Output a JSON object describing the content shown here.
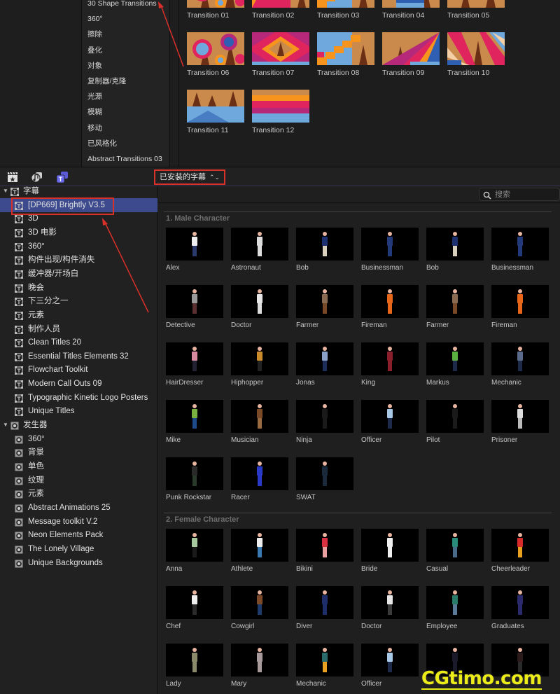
{
  "transitions_browser": {
    "categories": [
      "30 Shape Transitions",
      "360°",
      "擦除",
      "叠化",
      "对象",
      "复制器/克隆",
      "光源",
      "模糊",
      "移动",
      "已风格化",
      "Abstract Transitions 03"
    ],
    "items": [
      {
        "label": "Transition 01",
        "style": "circles"
      },
      {
        "label": "Transition 02",
        "style": "orange-zig"
      },
      {
        "label": "Transition 03",
        "style": "steps"
      },
      {
        "label": "Transition 04",
        "style": "blue-bar"
      },
      {
        "label": "Transition 05",
        "style": "rings"
      },
      {
        "label": "Transition 06",
        "style": "circles"
      },
      {
        "label": "Transition 07",
        "style": "diamond"
      },
      {
        "label": "Transition 08",
        "style": "steps"
      },
      {
        "label": "Transition 09",
        "style": "rays"
      },
      {
        "label": "Transition 10",
        "style": "rays2"
      },
      {
        "label": "Transition 11",
        "style": "trees-water"
      },
      {
        "label": "Transition 12",
        "style": "stripes"
      }
    ]
  },
  "toolbar": {
    "icons": [
      "clapper-star-icon",
      "music-photo-icon",
      "titles-generators-icon"
    ],
    "library_select": "已安装的字幕",
    "library_select_chevron": "⌃⌄"
  },
  "sidebar": {
    "groups": [
      {
        "label": "字幕",
        "expanded": true,
        "icon": "title-icon",
        "items": [
          {
            "label": "[DP669] Brightly V3.5",
            "selected": true
          },
          {
            "label": "3D"
          },
          {
            "label": "3D 电影"
          },
          {
            "label": "360°"
          },
          {
            "label": "构件出现/构件消失"
          },
          {
            "label": "缓冲器/开场白"
          },
          {
            "label": "晚会"
          },
          {
            "label": "下三分之一"
          },
          {
            "label": "元素"
          },
          {
            "label": "制作人员"
          },
          {
            "label": "Clean Titles 20"
          },
          {
            "label": "Essential Titles Elements 32"
          },
          {
            "label": "Flowchart Toolkit"
          },
          {
            "label": "Modern Call Outs 09"
          },
          {
            "label": "Typographic Kinetic Logo Posters"
          },
          {
            "label": "Unique Titles"
          }
        ]
      },
      {
        "label": "发生器",
        "expanded": true,
        "icon": "generator-icon",
        "items": [
          {
            "label": "360°"
          },
          {
            "label": "背景"
          },
          {
            "label": "单色"
          },
          {
            "label": "纹理"
          },
          {
            "label": "元素"
          },
          {
            "label": "Abstract Animations 25"
          },
          {
            "label": "Message toolkit V.2"
          },
          {
            "label": "Neon Elements Pack"
          },
          {
            "label": "The Lonely Village"
          },
          {
            "label": "Unique Backgrounds"
          }
        ]
      }
    ]
  },
  "search": {
    "placeholder": "搜索",
    "value": ""
  },
  "sections": [
    {
      "title": "1. Male Character",
      "items": [
        {
          "label": "Alex",
          "top": "#eeeeee",
          "bottom": "#2a3a6a"
        },
        {
          "label": "Astronaut",
          "top": "#dddddd",
          "bottom": "#dddddd"
        },
        {
          "label": "Bob",
          "top": "#1c2f6e",
          "bottom": "#d8d0bc"
        },
        {
          "label": "Businessman",
          "top": "#233a7a",
          "bottom": "#233a7a"
        },
        {
          "label": "Bob",
          "top": "#1c2f6e",
          "bottom": "#d8d0bc"
        },
        {
          "label": "Businessman",
          "top": "#233a7a",
          "bottom": "#233a7a"
        },
        {
          "label": "Detective",
          "top": "#9a9a9a",
          "bottom": "#5a3030"
        },
        {
          "label": "Doctor",
          "top": "#e6e6e6",
          "bottom": "#dddddd"
        },
        {
          "label": "Farmer",
          "top": "#8a6a50",
          "bottom": "#7a4a28"
        },
        {
          "label": "Fireman",
          "top": "#e8661a",
          "bottom": "#e8661a"
        },
        {
          "label": "Farmer",
          "top": "#8a6a50",
          "bottom": "#7a4a28"
        },
        {
          "label": "Fireman",
          "top": "#e8661a",
          "bottom": "#e8661a"
        },
        {
          "label": "HairDresser",
          "top": "#d88aa0",
          "bottom": "#222233"
        },
        {
          "label": "Hiphopper",
          "top": "#c88a2a",
          "bottom": "#222222"
        },
        {
          "label": "Jonas",
          "top": "#8aa0c8",
          "bottom": "#1e2e5a"
        },
        {
          "label": "King",
          "top": "#8a1e2a",
          "bottom": "#8a1e2a"
        },
        {
          "label": "Markus",
          "top": "#5ab040",
          "bottom": "#1e2a4a"
        },
        {
          "label": "Mechanic",
          "top": "#5a6a8a",
          "bottom": "#1e2a4a"
        },
        {
          "label": "Mike",
          "top": "#7ab040",
          "bottom": "#1e4a8a"
        },
        {
          "label": "Musician",
          "top": "#7a4a28",
          "bottom": "#9a6a40"
        },
        {
          "label": "Ninja",
          "top": "#1a1a1a",
          "bottom": "#1a1a1a"
        },
        {
          "label": "Officer",
          "top": "#a8c8e8",
          "bottom": "#1e2a4a"
        },
        {
          "label": "Pilot",
          "top": "#1a1a1a",
          "bottom": "#1a1a1a"
        },
        {
          "label": "Prisoner",
          "top": "#dddddd",
          "bottom": "#bbbbbb"
        },
        {
          "label": "Punk Rockstar",
          "top": "#2a2a2a",
          "bottom": "#2a3a2a"
        },
        {
          "label": "Racer",
          "top": "#2a3ac8",
          "bottom": "#2a3ac8"
        },
        {
          "label": "SWAT",
          "top": "#1a2a3a",
          "bottom": "#1a2a3a"
        }
      ]
    },
    {
      "title": "2. Female Character",
      "items": [
        {
          "label": "Anna",
          "top": "#a8c8a0",
          "bottom": "#1a1a1a"
        },
        {
          "label": "Athlete",
          "top": "#eeeeee",
          "bottom": "#3a7ab0"
        },
        {
          "label": "Bikini",
          "top": "#d83040",
          "bottom": "#e8a0a0"
        },
        {
          "label": "Bride",
          "top": "#f0f0f0",
          "bottom": "#f0f0f0"
        },
        {
          "label": "Casual",
          "top": "#2a8a7a",
          "bottom": "#4a6a8a"
        },
        {
          "label": "Cheerleader",
          "top": "#d82a2a",
          "bottom": "#e8a020"
        },
        {
          "label": "Chef",
          "top": "#eeeeee",
          "bottom": "#2a2a2a"
        },
        {
          "label": "Cowgirl",
          "top": "#7a4a28",
          "bottom": "#1e3a6a"
        },
        {
          "label": "Diver",
          "top": "#1e2e6a",
          "bottom": "#1e2e6a"
        },
        {
          "label": "Doctor",
          "top": "#e6e6e6",
          "bottom": "#3a3a3a"
        },
        {
          "label": "Employee",
          "top": "#2a7a6a",
          "bottom": "#5a7a9a"
        },
        {
          "label": "Graduates",
          "top": "#2a2a6a",
          "bottom": "#2a2a6a"
        },
        {
          "label": "Lady",
          "top": "#8a8a6a",
          "bottom": "#8a8a6a"
        },
        {
          "label": "Mary",
          "top": "#a89a9a",
          "bottom": "#a89a9a"
        },
        {
          "label": "Mechanic",
          "top": "#2a6a6a",
          "bottom": "#e8a020"
        },
        {
          "label": "Officer",
          "top": "#a8c8e8",
          "bottom": "#1e2a4a"
        },
        {
          "label": "",
          "top": "#1a1a2a",
          "bottom": "#1a1a2a"
        },
        {
          "label": "",
          "top": "#2a1a1a",
          "bottom": "#2a2a2a"
        }
      ]
    }
  ],
  "watermark": "CGtimo.com",
  "colors": {
    "selection": "#3d4a8e",
    "annotation_red": "#d9302a",
    "watermark_yellow": "#ecec18"
  }
}
